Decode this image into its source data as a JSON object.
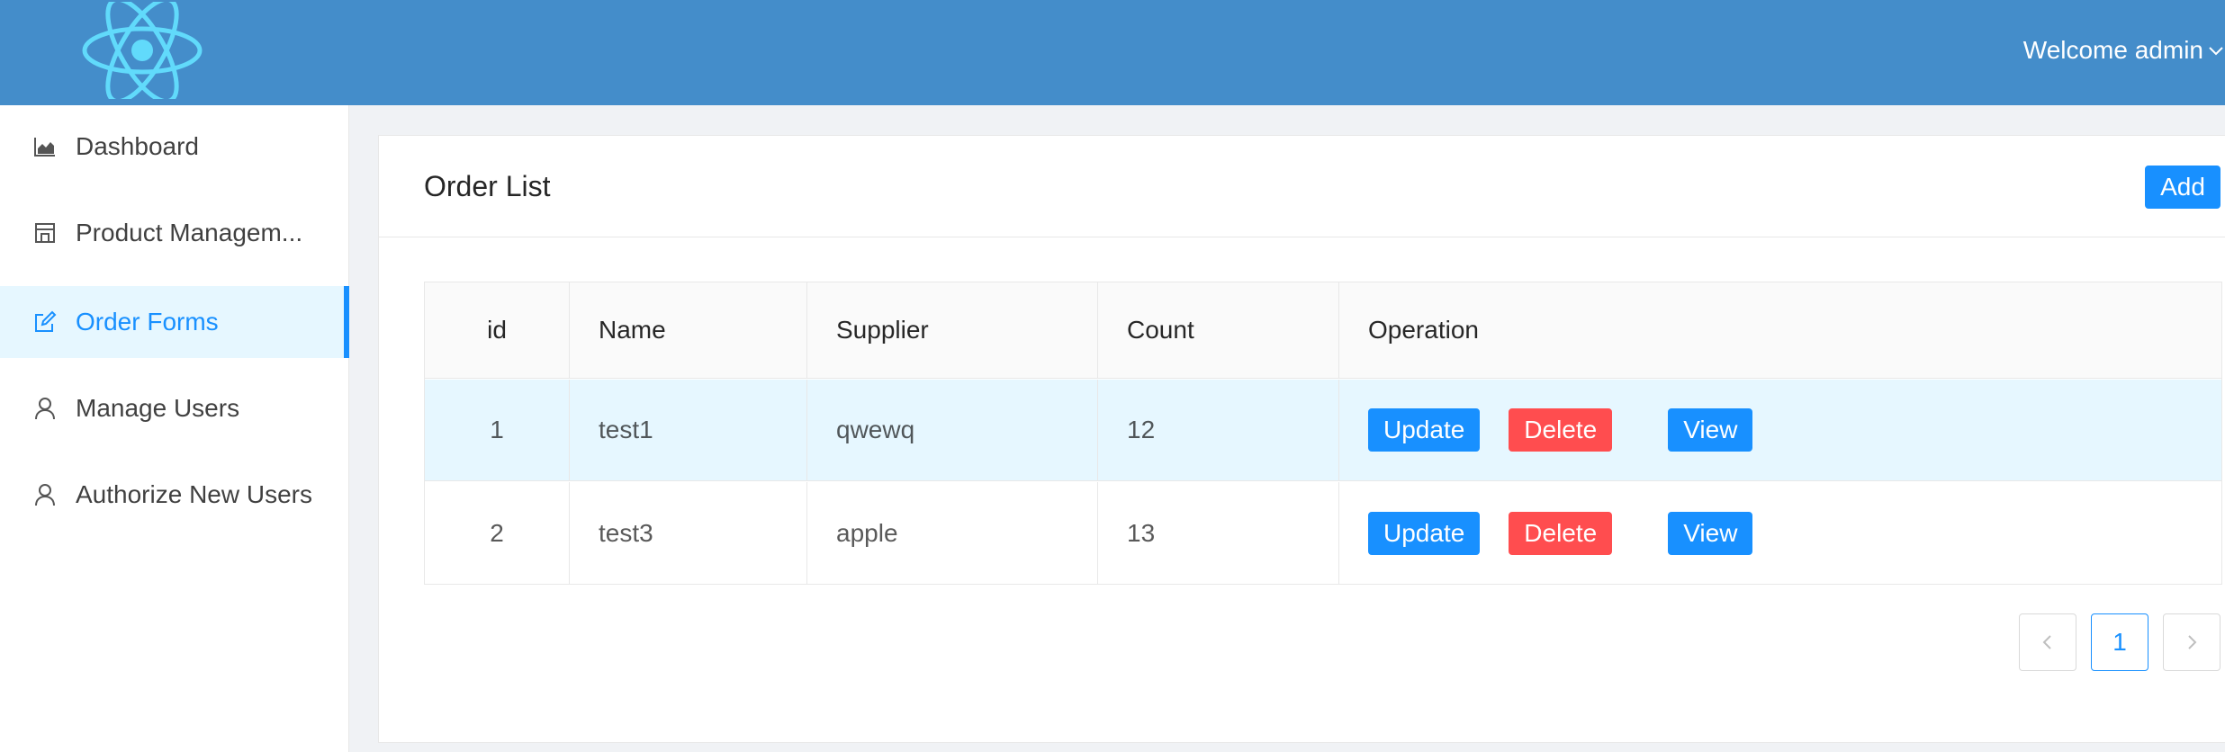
{
  "header": {
    "logo_icon": "react-atom-icon",
    "welcome_text": "Welcome admin",
    "brand_color": "#448dca"
  },
  "sidebar": {
    "items": [
      {
        "label": "Dashboard",
        "icon": "area-chart-icon"
      },
      {
        "label": "Product Managem...",
        "icon": "shop-icon"
      },
      {
        "label": "Order Forms",
        "icon": "edit-icon",
        "active": true
      },
      {
        "label": "Manage Users",
        "icon": "user-icon"
      },
      {
        "label": "Authorize New Users",
        "icon": "user-icon"
      }
    ]
  },
  "main": {
    "title": "Order List",
    "add_label": "Add",
    "table": {
      "columns": [
        "id",
        "Name",
        "Supplier",
        "Count",
        "Operation"
      ],
      "rows": [
        {
          "id": "1",
          "name": "test1",
          "supplier": "qwewq",
          "count": "12"
        },
        {
          "id": "2",
          "name": "test3",
          "supplier": "apple",
          "count": "13"
        }
      ],
      "actions": {
        "update": "Update",
        "delete": "Delete",
        "view": "View"
      }
    },
    "pagination": {
      "current": "1"
    }
  },
  "colors": {
    "primary": "#1890ff",
    "danger": "#ff4d4f",
    "selected_row": "#e6f7ff"
  }
}
